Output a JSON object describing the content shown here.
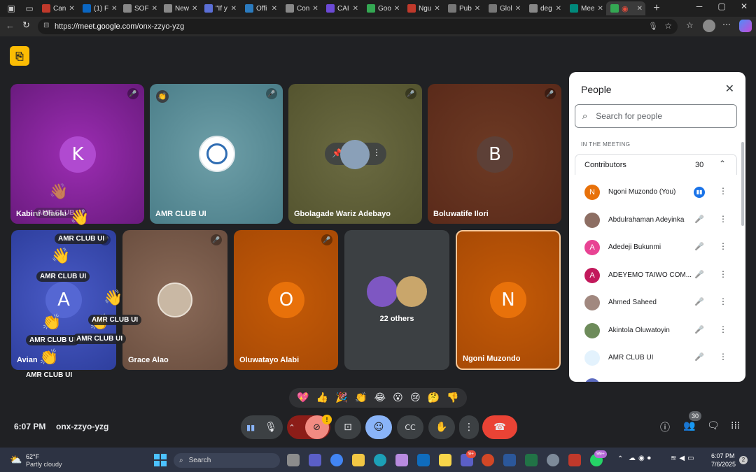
{
  "browser": {
    "tabs": [
      {
        "label": "Can",
        "color": "#c0392b"
      },
      {
        "label": "(1) F",
        "color": "#0a66c2"
      },
      {
        "label": "SOF",
        "color": "#888888"
      },
      {
        "label": "New",
        "color": "#888888"
      },
      {
        "label": "\"If y",
        "color": "#5b6fd6"
      },
      {
        "label": "Offi",
        "color": "#2b7bbf"
      },
      {
        "label": "Con",
        "color": "#888888"
      },
      {
        "label": "CAI",
        "color": "#6c4ad6"
      },
      {
        "label": "Goo",
        "color": "#34a853"
      },
      {
        "label": "Ngu",
        "color": "#c0392b"
      },
      {
        "label": "Pub",
        "color": "#777777"
      },
      {
        "label": "Glol",
        "color": "#777777"
      },
      {
        "label": "deg",
        "color": "#888888"
      },
      {
        "label": "Mee",
        "color": "#00897b"
      }
    ],
    "url_prefix": "https://",
    "url_host": "meet.google.com",
    "url_path": "/onx-zzyo-yzg"
  },
  "tiles": [
    {
      "name": "Kabiru Olaolu",
      "initial": "K"
    },
    {
      "name": "AMR CLUB UI",
      "initial": ""
    },
    {
      "name": "Gbolagade Wariz Adebayo",
      "initial": ""
    },
    {
      "name": "Boluwatife Ilori",
      "initial": "B"
    },
    {
      "name": "Avian",
      "initial": "A"
    },
    {
      "name": "Grace Alao",
      "initial": ""
    },
    {
      "name": "Oluwatayo Alabi",
      "initial": "O"
    },
    {
      "name": "22 others",
      "initial": ""
    },
    {
      "name": "Ngoni Muzondo",
      "initial": "N"
    }
  ],
  "reactions": {
    "label": "AMR CLUB UI",
    "clap": "👏",
    "wave": "👋"
  },
  "people_panel": {
    "title": "People",
    "search_placeholder": "Search for people",
    "section_label": "IN THE MEETING",
    "group_label": "Contributors",
    "group_count": "30",
    "people": [
      {
        "name": "Ngoni Muzondo (You)",
        "initial": "N",
        "color": "#e8710a"
      },
      {
        "name": "Abdulrahaman Adeyinka",
        "initial": "",
        "color": "#8d6e63"
      },
      {
        "name": "Adedeji Bukunmi",
        "initial": "A",
        "color": "#e84393"
      },
      {
        "name": "ADEYEMO TAIWO COM...",
        "initial": "A",
        "color": "#c2185b"
      },
      {
        "name": "Ahmed Saheed",
        "initial": "",
        "color": "#a1887f"
      },
      {
        "name": "Akintola Oluwatoyin",
        "initial": "",
        "color": "#6d8b5a"
      },
      {
        "name": "AMR CLUB UI",
        "initial": "",
        "color": "#e3f2fd"
      }
    ]
  },
  "emoji_bar": [
    "💖",
    "👍",
    "🎉",
    "👏",
    "😂",
    "😮",
    "😢",
    "🤔",
    "👎"
  ],
  "bottom_bar": {
    "time": "6:07 PM",
    "meeting_code": "onx-zzyo-yzg",
    "participants_badge": "30"
  },
  "taskbar": {
    "temperature": "62°F",
    "condition": "Partly cloudy",
    "search": "Search",
    "time": "6:07 PM",
    "date": "7/6/2025",
    "whatsapp_badge": "99+",
    "teams_badge": "9+",
    "notification_count": "2"
  }
}
